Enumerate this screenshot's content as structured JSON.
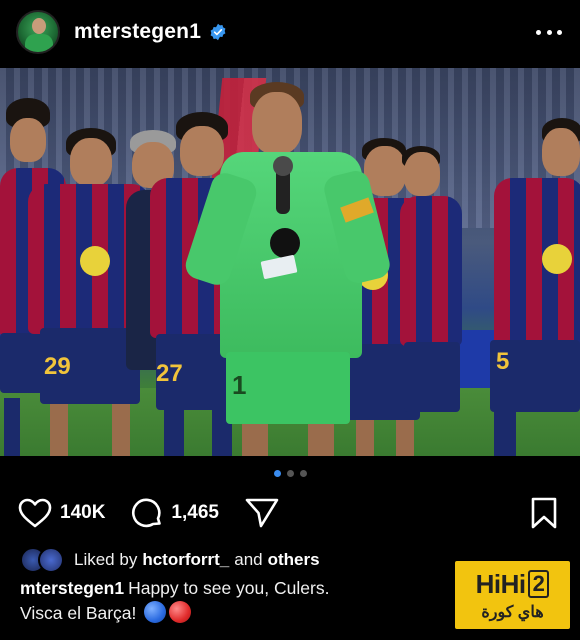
{
  "header": {
    "username": "mterstegen1",
    "verified": true,
    "avatar_icon": "profile-avatar",
    "more_icon": "more-horizontal-icon"
  },
  "post": {
    "image_description_icon": "team-photo",
    "carousel": {
      "count": 3,
      "active_index": 0
    }
  },
  "actions": {
    "likes_count": "140K",
    "comments_count": "1,465",
    "like_icon": "heart-icon",
    "comment_icon": "comment-bubble-icon",
    "share_icon": "send-icon",
    "save_icon": "bookmark-icon"
  },
  "likes_line": {
    "prefix": "Liked by",
    "user": "hctorforrt_",
    "middle": "and",
    "others": "others"
  },
  "caption": {
    "author": "mterstegen1",
    "text_line1": "Happy to see you, Culers.",
    "text_line2": "Visca el Barça!"
  },
  "watermark": {
    "brand": "HiHi",
    "brand_num": "2",
    "arabic": "هاي كورة"
  },
  "colors": {
    "background": "#000000",
    "accent_blue": "#3a8cf0",
    "verified_blue": "#3897f0",
    "watermark_yellow": "#f2c40f"
  }
}
